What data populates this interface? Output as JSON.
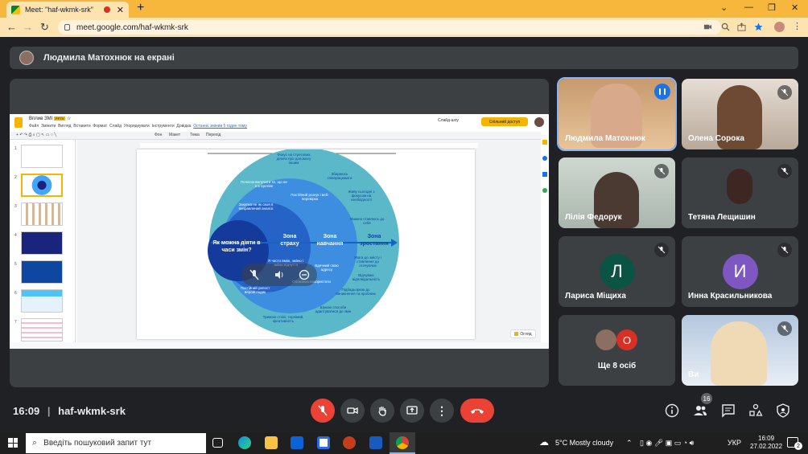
{
  "browser": {
    "tab_title": "Meet: \"haf-wkmk-srk\"",
    "url": "meet.google.com/haf-wkmk-srk"
  },
  "meet": {
    "presenting_banner": "Людмила Матохнюк на екрані",
    "meeting_time": "16:09",
    "meeting_code": "haf-wkmk-srk",
    "participants_count": "16",
    "participants": [
      {
        "name": "Людмила Матохнюк",
        "speaking": true
      },
      {
        "name": "Олена Сорока",
        "muted": true
      },
      {
        "name": "Лілія Федорук",
        "muted": true
      },
      {
        "name": "Тетяна Лещишин",
        "muted": true
      },
      {
        "name": "Лариса Міщиха",
        "initial": "Л",
        "color": "#0b5345",
        "muted": true
      },
      {
        "name": "Инна Красильникова",
        "initial": "И",
        "color": "#7e57c2",
        "muted": true
      },
      {
        "name": "Ще 8 осіб",
        "initial": "О",
        "color": "#d93025"
      },
      {
        "name": "Ви",
        "muted": true
      }
    ]
  },
  "slides": {
    "doc_title": "Вплив ЗМІ",
    "badge": "PPTX",
    "menu": [
      "Файл",
      "Змінити",
      "Вигляд",
      "Вставити",
      "Формат",
      "Слайд",
      "Упорядкувати",
      "Інструменти",
      "Довідка"
    ],
    "last_edit": "Останнє змінив 5 годин тому",
    "slideshow_label": "Слайд-шоу",
    "share_label": "Спільний доступ",
    "toolbar_items": [
      "Фон",
      "Макет",
      "Тема",
      "Перехід"
    ],
    "thumb_numbers": [
      "1",
      "2",
      "3",
      "4",
      "5",
      "6",
      "7"
    ],
    "zones": {
      "center": "Як можна діяти в часи змін?",
      "fear": "Зона страху",
      "learning": "Зона навчання",
      "growth": "Зона зростання"
    },
    "circle_texts": {
      "t1": "Фокус на стресових діянях про допомогу іншим",
      "t2": "Початок вилучати те, що не я в протіве",
      "t3": "Закупка не як своя в виправлений аналізі",
      "t4": "Постійний розгук і веб-перевірка",
      "t5": "Постійний репост версій подяк",
      "t6": "Я часто вмію, зміню і зміню відчуття",
      "t7": "Обожнюю використати",
      "t8": "Уважно ставлюсь до себе",
      "t9": "Збираюсь співпрацювати",
      "t10": "Живу сьогодні з фокусом на необхідності",
      "t11": "Вдячний свою адресу",
      "t12": "Відчуваю відповідальність",
      "t13": "Шукаю способи адаптуватися до змін",
      "t14": "Увага до змісту і ставлення до оточуючих",
      "t15": "Підбадьорюю до виникнення та проблем",
      "t16": "Тримаю стоікі, терпімий, креативність"
    },
    "notes_label": "Огляд"
  },
  "taskbar": {
    "search_placeholder": "Введіть пошуковий запит тут",
    "weather": "5°C  Mostly cloudy",
    "lang": "УКР",
    "time": "16:09",
    "date": "27.02.2022",
    "notif_count": "2"
  }
}
